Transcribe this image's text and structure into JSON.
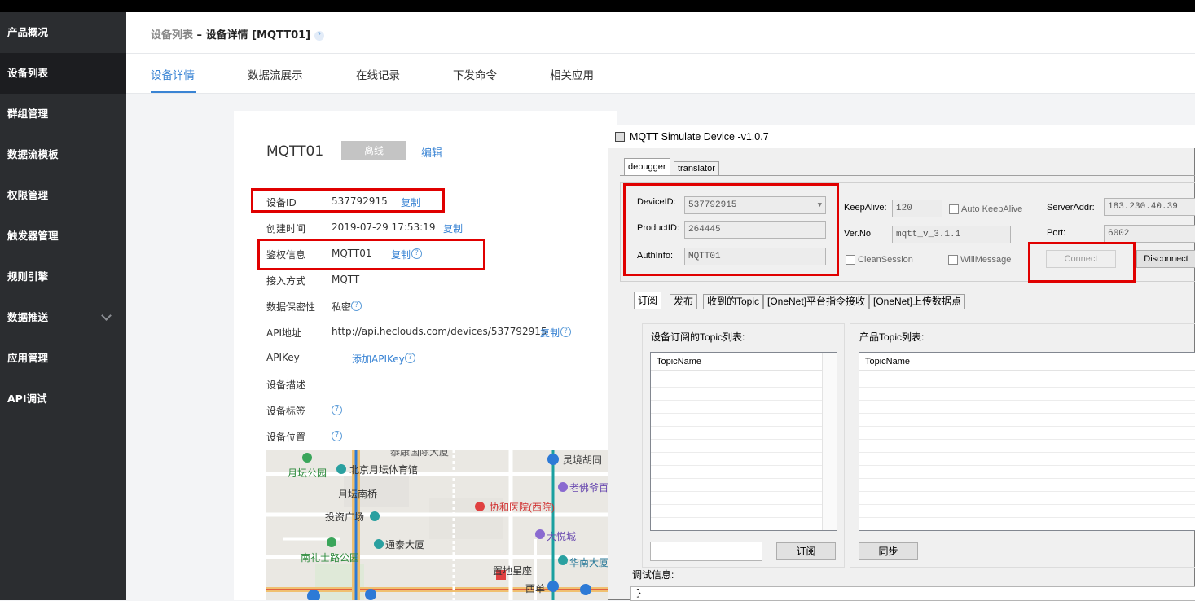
{
  "sidebar": {
    "items": [
      {
        "label": "产品概况"
      },
      {
        "label": "设备列表"
      },
      {
        "label": "群组管理"
      },
      {
        "label": "数据流模板"
      },
      {
        "label": "权限管理"
      },
      {
        "label": "触发器管理"
      },
      {
        "label": "规则引擎"
      },
      {
        "label": "数据推送"
      },
      {
        "label": "应用管理"
      },
      {
        "label": "API调试"
      }
    ]
  },
  "breadcrumb": {
    "parent": "设备列表",
    "sep": " – ",
    "current": "设备详情 [MQTT01]",
    "help": "?"
  },
  "tabs": [
    "设备详情",
    "数据流展示",
    "在线记录",
    "下发命令",
    "相关应用"
  ],
  "device": {
    "name": "MQTT01",
    "status": "离线",
    "edit": "编辑",
    "copy": "复制",
    "help": "?",
    "fields": {
      "id_label": "设备ID",
      "id_value": "537792915",
      "created_label": "创建时间",
      "created_value": "2019-07-29 17:53:19",
      "auth_label": "鉴权信息",
      "auth_value": "MQTT01",
      "access_label": "接入方式",
      "access_value": "MQTT",
      "privacy_label": "数据保密性",
      "privacy_value": "私密",
      "api_label": "API地址",
      "api_value": "http://api.heclouds.com/devices/537792915",
      "apikey_label": "APIKey",
      "apikey_value": "添加APIKey",
      "desc_label": "设备描述",
      "tags_label": "设备标签",
      "location_label": "设备位置"
    }
  },
  "map": {
    "labels": [
      "泰康国际大厦",
      "灵境胡同",
      "月坛公园",
      "北京月坛体育馆",
      "老佛爷百",
      "月坛南桥",
      "投资广场",
      "协和医院(西院)",
      "大悦城",
      "通泰大厦",
      "南礼士路公园",
      "华南大厦",
      "置地星座",
      "西单"
    ]
  },
  "mqtt": {
    "title": "MQTT Simulate Device  -v1.0.7",
    "tabs": [
      "debugger",
      "translator"
    ],
    "device_id_label": "DeviceID:",
    "device_id": "537792915",
    "product_id_label": "ProductID:",
    "product_id": "264445",
    "auth_info_label": "AuthInfo:",
    "auth_info": "MQTT01",
    "keepalive_label": "KeepAlive:",
    "keepalive": "120",
    "auto_keepalive": "Auto KeepAlive",
    "server_label": "ServerAddr:",
    "server": "183.230.40.39",
    "verno_label": "Ver.No",
    "verno": "mqtt_v_3.1.1",
    "port_label": "Port:",
    "port": "6002",
    "clean_session": "CleanSession",
    "will_message": "WillMessage",
    "connect": "Connect",
    "disconnect": "Disconnect",
    "inner_tabs": [
      "订阅",
      "发布",
      "收到的Topic",
      "[OneNet]平台指令接收",
      "[OneNet]上传数据点"
    ],
    "sub_list_title": "设备订阅的Topic列表:",
    "prod_list_title": "产品Topic列表:",
    "topic_col": "TopicName",
    "subscribe_btn": "订阅",
    "sync_btn": "同步",
    "debug_label": "调试信息:",
    "debug_text": "}"
  }
}
